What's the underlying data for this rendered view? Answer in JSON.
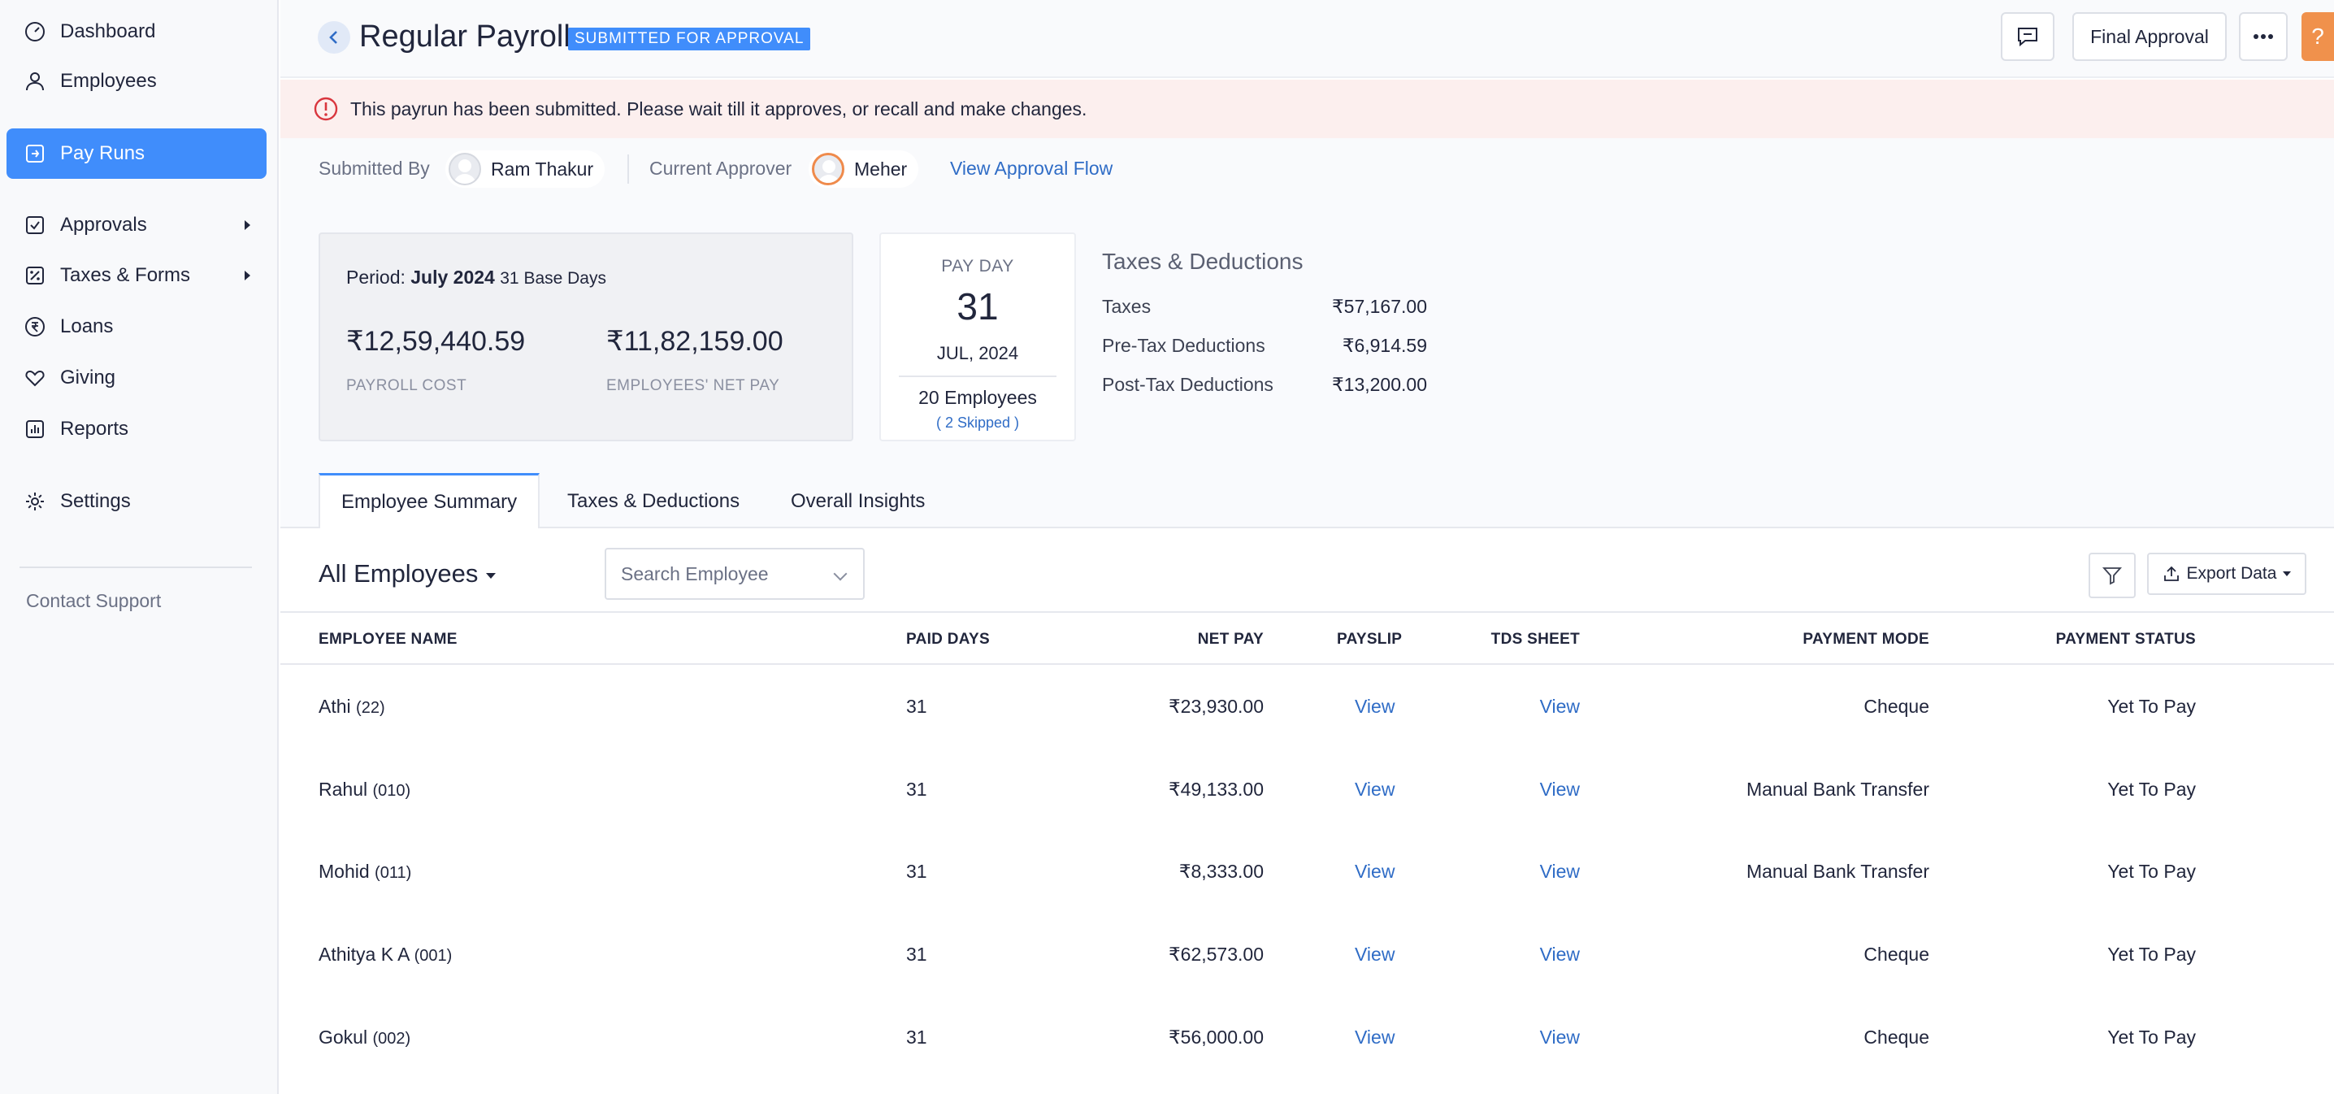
{
  "sidebar": {
    "items": [
      {
        "label": "Dashboard",
        "icon": "dashboard-icon"
      },
      {
        "label": "Employees",
        "icon": "user-icon"
      },
      {
        "label": "Pay Runs",
        "icon": "payrun-icon"
      },
      {
        "label": "Approvals",
        "icon": "approval-icon"
      },
      {
        "label": "Taxes & Forms",
        "icon": "tax-form-icon"
      },
      {
        "label": "Loans",
        "icon": "rupee-icon"
      },
      {
        "label": "Giving",
        "icon": "heart-icon"
      },
      {
        "label": "Reports",
        "icon": "report-icon"
      },
      {
        "label": "Settings",
        "icon": "gear-icon"
      }
    ],
    "contact_support": "Contact Support"
  },
  "header": {
    "title": "Regular Payroll",
    "badge": "SUBMITTED FOR APPROVAL",
    "final_approval": "Final Approval",
    "help": "?"
  },
  "alert": {
    "message": "This payrun has been submitted. Please wait till it approves, or recall and make changes."
  },
  "approval": {
    "submitted_by_label": "Submitted By",
    "submitted_by": "Ram Thakur",
    "current_approver_label": "Current Approver",
    "current_approver": "Meher",
    "view_flow": "View Approval Flow"
  },
  "summary": {
    "period_label": "Period:",
    "period": "July 2024",
    "base_days": "31 Base Days",
    "payroll_cost": "₹12,59,440.59",
    "payroll_cost_label": "PAYROLL COST",
    "net_pay": "₹11,82,159.00",
    "net_pay_label": "EMPLOYEES' NET PAY",
    "payday_label": "PAY DAY",
    "payday_day": "31",
    "payday_month": "JUL, 2024",
    "employees": "20 Employees",
    "skipped": "( 2 Skipped )"
  },
  "taxes_deductions": {
    "title": "Taxes & Deductions",
    "rows": [
      {
        "label": "Taxes",
        "value": "₹57,167.00"
      },
      {
        "label": "Pre-Tax Deductions",
        "value": "₹6,914.59"
      },
      {
        "label": "Post-Tax Deductions",
        "value": "₹13,200.00"
      }
    ]
  },
  "tabs": [
    "Employee Summary",
    "Taxes & Deductions",
    "Overall Insights"
  ],
  "table": {
    "filter_label": "All Employees",
    "search_placeholder": "Search Employee",
    "export_label": "Export Data",
    "columns": [
      "EMPLOYEE NAME",
      "PAID DAYS",
      "NET PAY",
      "PAYSLIP",
      "TDS SHEET",
      "PAYMENT MODE",
      "PAYMENT STATUS"
    ],
    "rows": [
      {
        "name": "Athi",
        "code": "(22)",
        "paid_days": "31",
        "net_pay": "₹23,930.00",
        "payslip": "View",
        "tds": "View",
        "mode": "Cheque",
        "status": "Yet To Pay"
      },
      {
        "name": "Rahul",
        "code": "(010)",
        "paid_days": "31",
        "net_pay": "₹49,133.00",
        "payslip": "View",
        "tds": "View",
        "mode": "Manual Bank Transfer",
        "status": "Yet To Pay"
      },
      {
        "name": "Mohid",
        "code": "(011)",
        "paid_days": "31",
        "net_pay": "₹8,333.00",
        "payslip": "View",
        "tds": "View",
        "mode": "Manual Bank Transfer",
        "status": "Yet To Pay"
      },
      {
        "name": "Athitya K A",
        "code": "(001)",
        "paid_days": "31",
        "net_pay": "₹62,573.00",
        "payslip": "View",
        "tds": "View",
        "mode": "Cheque",
        "status": "Yet To Pay"
      },
      {
        "name": "Gokul",
        "code": "(002)",
        "paid_days": "31",
        "net_pay": "₹56,000.00",
        "payslip": "View",
        "tds": "View",
        "mode": "Cheque",
        "status": "Yet To Pay"
      }
    ]
  },
  "colors": {
    "accent": "#408dfb",
    "link": "#2f6cc6",
    "alert_bg": "#fcefee",
    "help_button": "#f0914c"
  }
}
